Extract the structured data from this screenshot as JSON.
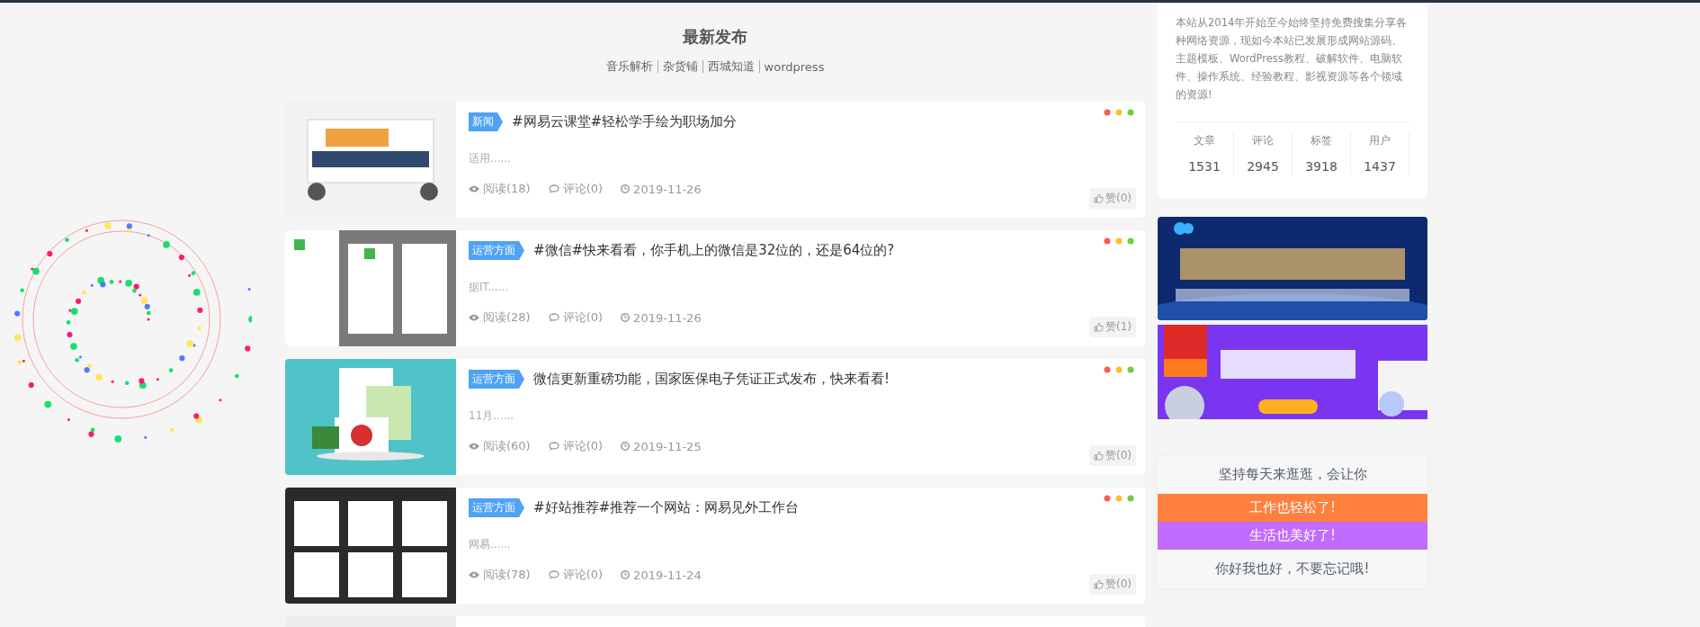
{
  "section": {
    "title": "最新发布",
    "links": [
      "音乐解析",
      "杂货铺",
      "西城知道",
      "wordpress"
    ]
  },
  "posts": [
    {
      "tag": "新闻",
      "title": "#网易云课堂#轻松学手绘为职场加分",
      "excerpt": "适用......",
      "views": "阅读(18)",
      "comments": "评论(0)",
      "date": "2019-11-26",
      "likes": "赞(0)"
    },
    {
      "tag": "运营方面",
      "title": "#微信#快来看看，你手机上的微信是32位的，还是64位的?",
      "excerpt": "据IT......",
      "views": "阅读(28)",
      "comments": "评论(0)",
      "date": "2019-11-26",
      "likes": "赞(1)"
    },
    {
      "tag": "运营方面",
      "title": "微信更新重磅功能，国家医保电子凭证正式发布，快来看看!",
      "excerpt": "11月......",
      "views": "阅读(60)",
      "comments": "评论(0)",
      "date": "2019-11-25",
      "likes": "赞(0)"
    },
    {
      "tag": "运营方面",
      "title": "#好站推荐#推荐一个网站：网易见外工作台",
      "excerpt": "网易......",
      "views": "阅读(78)",
      "comments": "评论(0)",
      "date": "2019-11-24",
      "likes": "赞(0)"
    }
  ],
  "sidebar": {
    "intro": "本站从2014年开始至今始终坚持免费搜集分享各种网络资源，现如今本站已发展形成网站源码、主题模板、WordPress教程、破解软件、电脑软件、操作系统、经验教程、影视资源等各个领域的资源!",
    "stats": [
      {
        "label": "文章",
        "value": "1531"
      },
      {
        "label": "评论",
        "value": "2945"
      },
      {
        "label": "标签",
        "value": "3918"
      },
      {
        "label": "用户",
        "value": "1437"
      }
    ],
    "slogans": [
      {
        "text": "坚持每天来逛逛，会让你",
        "color": "#f7f7f7"
      },
      {
        "text": "工作也轻松了!",
        "color": "#ff7f3f"
      },
      {
        "text": "生活也美好了!",
        "color": "#c26bff"
      },
      {
        "text": "你好我也好，不要忘记哦!",
        "color": "#f7f7f7"
      }
    ]
  }
}
